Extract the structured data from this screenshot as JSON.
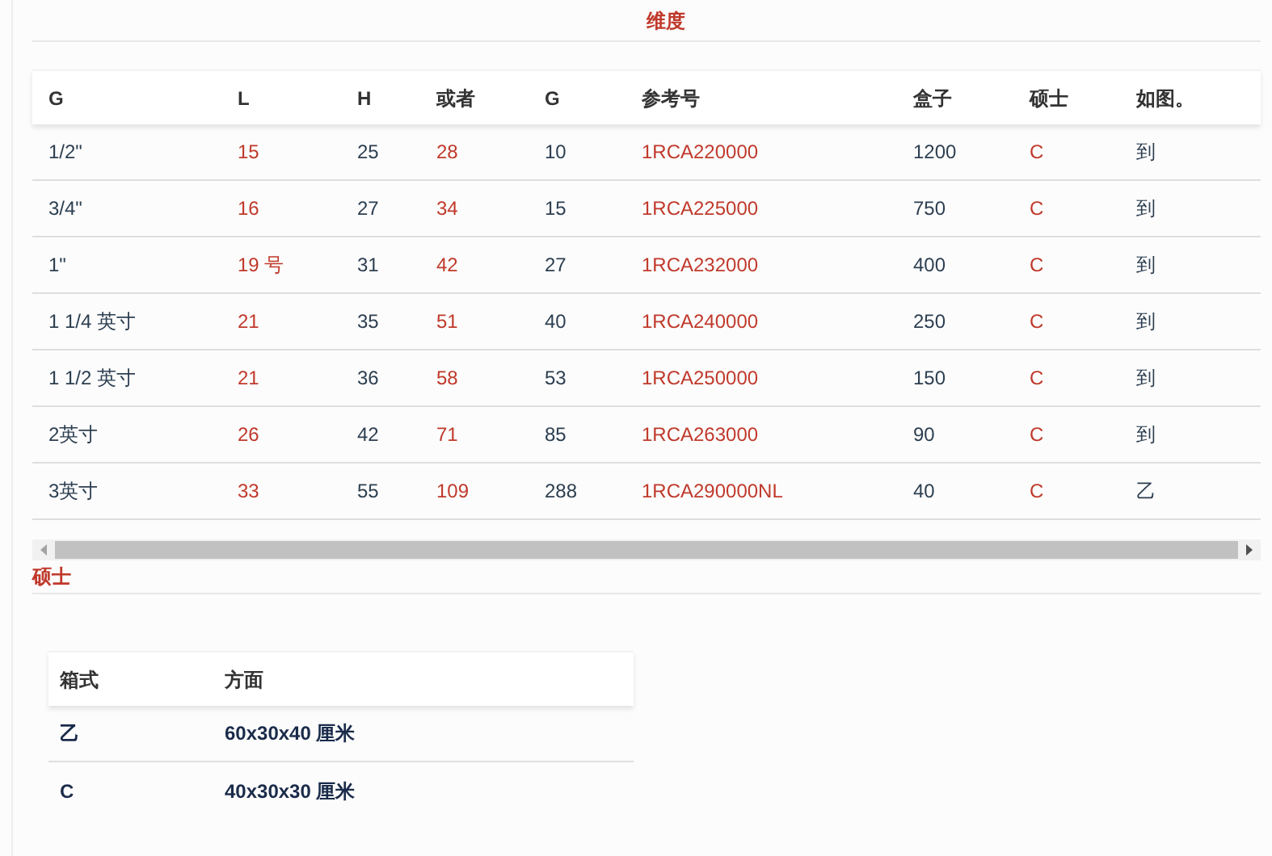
{
  "title": "维度",
  "table": {
    "columns": [
      {
        "label": "G",
        "highlight": false
      },
      {
        "label": "L",
        "highlight": true
      },
      {
        "label": "H",
        "highlight": false
      },
      {
        "label": "或者",
        "highlight": true
      },
      {
        "label": "G",
        "highlight": false
      },
      {
        "label": "参考号",
        "highlight": true
      },
      {
        "label": "盒子",
        "highlight": false
      },
      {
        "label": "硕士",
        "highlight": true
      },
      {
        "label": "如图。",
        "highlight": false
      }
    ],
    "rows": [
      [
        "1/2\"",
        "15",
        "25",
        "28",
        "10",
        "1RCA220000",
        "1200",
        "C",
        "到"
      ],
      [
        "3/4\"",
        "16",
        "27",
        "34",
        "15",
        "1RCA225000",
        "750",
        "C",
        "到"
      ],
      [
        "1\"",
        "19 号",
        "31",
        "42",
        "27",
        "1RCA232000",
        "400",
        "C",
        "到"
      ],
      [
        "1 1/4 英寸",
        "21",
        "35",
        "51",
        "40",
        "1RCA240000",
        "250",
        "C",
        "到"
      ],
      [
        "1 1/2 英寸",
        "21",
        "36",
        "58",
        "53",
        "1RCA250000",
        "150",
        "C",
        "到"
      ],
      [
        "2英寸",
        "26",
        "42",
        "71",
        "85",
        "1RCA263000",
        "90",
        "C",
        "到"
      ],
      [
        "3英寸",
        "33",
        "55",
        "109",
        "288",
        "1RCA290000NL",
        "40",
        "C",
        "乙"
      ]
    ]
  },
  "section_title": "硕士",
  "box_table": {
    "columns": [
      "箱式",
      "方面"
    ],
    "rows": [
      [
        "乙",
        "60x30x40 厘米"
      ],
      [
        "C",
        "40x30x30 厘米"
      ]
    ]
  }
}
